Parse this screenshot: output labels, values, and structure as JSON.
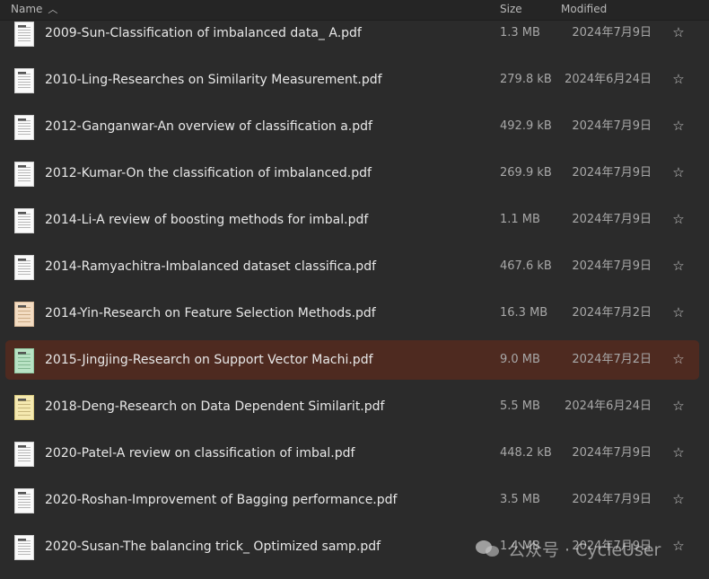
{
  "header": {
    "name_label": "Name",
    "sort_icon": "chevron-up-icon",
    "size_label": "Size",
    "modified_label": "Modified"
  },
  "files": [
    {
      "name": "2009-Sun-Classification of imbalanced data_ A.pdf",
      "size": "1.3 MB",
      "modified": "2024年7月9日",
      "thumb": "doc",
      "selected": false
    },
    {
      "name": "2010-Ling-Researches on Similarity Measurement.pdf",
      "size": "279.8 kB",
      "modified": "2024年6月24日",
      "thumb": "doc",
      "selected": false
    },
    {
      "name": "2012-Ganganwar-An overview of classification a.pdf",
      "size": "492.9 kB",
      "modified": "2024年7月9日",
      "thumb": "doc",
      "selected": false
    },
    {
      "name": "2012-Kumar-On the classification of imbalanced.pdf",
      "size": "269.9 kB",
      "modified": "2024年7月9日",
      "thumb": "doc",
      "selected": false
    },
    {
      "name": "2014-Li-A review of boosting methods for imbal.pdf",
      "size": "1.1 MB",
      "modified": "2024年7月9日",
      "thumb": "doc",
      "selected": false
    },
    {
      "name": "2014-Ramyachitra-Imbalanced dataset classifica.pdf",
      "size": "467.6 kB",
      "modified": "2024年7月9日",
      "thumb": "doc",
      "selected": false
    },
    {
      "name": "2014-Yin-Research on Feature Selection Methods.pdf",
      "size": "16.3 MB",
      "modified": "2024年7月2日",
      "thumb": "cover-tan",
      "selected": false
    },
    {
      "name": "2015-Jingjing-Research on Support Vector Machi.pdf",
      "size": "9.0 MB",
      "modified": "2024年7月2日",
      "thumb": "cover-green",
      "selected": true
    },
    {
      "name": "2018-Deng-Research on Data Dependent Similarit.pdf",
      "size": "5.5 MB",
      "modified": "2024年6月24日",
      "thumb": "cover-yellow",
      "selected": false
    },
    {
      "name": "2020-Patel-A review on classification of imbal.pdf",
      "size": "448.2 kB",
      "modified": "2024年7月9日",
      "thumb": "doc",
      "selected": false
    },
    {
      "name": "2020-Roshan-Improvement of Bagging performance.pdf",
      "size": "3.5 MB",
      "modified": "2024年7月9日",
      "thumb": "doc",
      "selected": false
    },
    {
      "name": "2020-Susan-The balancing trick_ Optimized samp.pdf",
      "size": "1.4 MB",
      "modified": "2024年7月9日",
      "thumb": "doc",
      "selected": false
    }
  ],
  "star_glyph": "☆",
  "watermark": {
    "icon": "wechat-icon",
    "text": "公众号 · CycleUser"
  }
}
